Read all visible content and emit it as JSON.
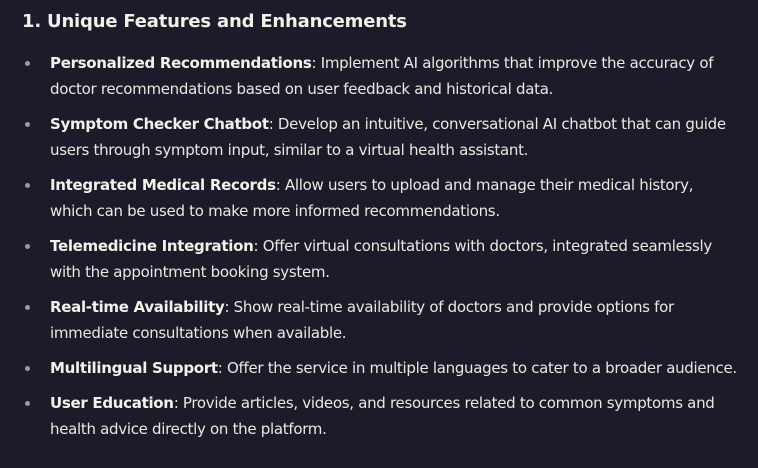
{
  "section": {
    "title": "1. Unique Features and Enhancements"
  },
  "features": [
    {
      "term": "Personalized Recommendations",
      "description": ": Implement AI algorithms that improve the accuracy of doctor recommendations based on user feedback and historical data."
    },
    {
      "term": "Symptom Checker Chatbot",
      "description": ": Develop an intuitive, conversational AI chatbot that can guide users through symptom input, similar to a virtual health assistant."
    },
    {
      "term": "Integrated Medical Records",
      "description": ": Allow users to upload and manage their medical history, which can be used to make more informed recommendations."
    },
    {
      "term": "Telemedicine Integration",
      "description": ": Offer virtual consultations with doctors, integrated seamlessly with the appointment booking system."
    },
    {
      "term": "Real-time Availability",
      "description": ": Show real-time availability of doctors and provide options for immediate consultations when available."
    },
    {
      "term": "Multilingual Support",
      "description": ": Offer the service in multiple languages to cater to a broader audience."
    },
    {
      "term": "User Education",
      "description": ": Provide articles, videos, and resources related to common symptoms and health advice directly on the platform."
    }
  ],
  "colors": {
    "background": "#1c1b29",
    "text": "#ece8e1",
    "bullet": "#9c9aa6"
  }
}
